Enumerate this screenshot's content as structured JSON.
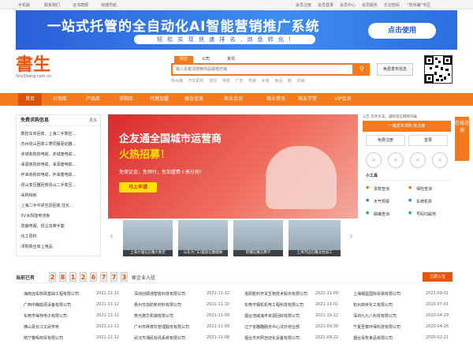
{
  "topbar": {
    "items": [
      "手机版",
      "联系我们",
      "证书荫铜",
      "快捷导航"
    ],
    "right": [
      "会员注册",
      "会员登录",
      "会员中心",
      "会员服务",
      "忘记密码",
      "“防伪骗”专区"
    ]
  },
  "banner": {
    "headline": "一站式托管的全自动化AI智能营销推广系统",
    "sub": "轻 松 实 现 快 速 排 名 , 询 盘 转 化 !",
    "button": "点击使用"
  },
  "logo": {
    "text": "書生",
    "domain": "ShuSheng.com.cn"
  },
  "search": {
    "tabs": [
      "供应",
      "公司",
      "资讯"
    ],
    "placeholder": "输入关键词搜索商品或者店铺",
    "hot": [
      "热水器",
      "汽车配件",
      "安防",
      "电缆",
      "广告",
      "男装",
      "女装",
      "食品",
      "鞋",
      "机械"
    ],
    "publish": "免费发布信息"
  },
  "nav": [
    "首页",
    "公司库",
    "产品库",
    "求购库",
    "代理加盟",
    "展会信息",
    "商业会议",
    "商业资讯",
    "商友学堂",
    "VIP会员"
  ],
  "left": {
    "title": "免费求购信息",
    "more": "更多",
    "items": [
      "·数控车床回收，上海二手数控...",
      "·苏州昆山回收三菱伺服驱动器...",
      "·赤城收购旧电缆，赤城废电缆...",
      "·涞源收购旧电缆，涞源废电缆...",
      "·怀来收购旧电缆，怀来废电缆...",
      "·昆山变压器回收昆山二手变压...",
      "·采购锌板",
      "·上海二手中央空调回收,住化...",
      "·5V太阳能电池板",
      "·防静电服，低尘凉爽手套",
      "·化工原料",
      "·求购真丝床上用品"
    ]
  },
  "hero": {
    "title1": "企友通全国城市运营商",
    "title2": "火热招募！",
    "line": "免保证金，免预付，免加盟费＋高分润！",
    "button": "马上申请"
  },
  "thumbs": [
    "上海大理石石雕大象定",
    "山东大门口摆放石雕貔貅",
    "新疆石雕石狮子",
    "上海河边石雕龙柱加工"
  ],
  "right": {
    "notice": "公告 年终岁末，谨防电信网络诈骗",
    "btn": "一键发布求购 免注册",
    "register": "免费注册",
    "login": "登录",
    "tools_title": "小工具",
    "tools": [
      "货款查询",
      "保险查询",
      "天气预报",
      "车牌机票",
      "邮编查询",
      "号码归属地"
    ],
    "float": "在线咨询"
  },
  "counter": {
    "label": "当前已有",
    "digits": [
      "2",
      "8",
      "1",
      "2",
      "6",
      "7",
      "7",
      "3"
    ],
    "suffix": "家企业入驻",
    "join": "立即入住"
  },
  "companies": [
    [
      "海南远佑劳政基础工程有限公司",
      "2021-11-12",
      "深圳创顺通智能科技有限公司",
      "2021-11-12",
      "洛阳乾科开关生物技术股份有限公司",
      "2021-11-09",
      "上海钢盈国际贸易有限公司",
      "2021-09-01"
    ],
    [
      "广西中胸能源设备有限公司",
      "2021-11-12",
      "惠州市加防新材料有限公司",
      "2021-11-10",
      "东莞市钢机机电工程科技有限公司",
      "2021-11-01",
      "杭州高侨化工有限公司",
      "2020-07-01"
    ],
    [
      "东莞市得林电子有限公司",
      "2021-11-12",
      "寿光德华机械有限公司",
      "2021-11-09",
      "烟台浩威海丰资源回收有限公司",
      "2021-10-22",
      "深圳九九八科技有限公司",
      "2020-04-29"
    ],
    [
      "佛山县长江文武学校",
      "2021-11-12",
      "广州市骅尊饮管理服务有限公司",
      "2021-11-09",
      "辽宁省瞄瞄服务中心法外劳业部",
      "2021-09-30",
      "宁夏圣泰环保科技有限公司",
      "2020-04-26"
    ],
    [
      "南宁春晖商贸有限公司",
      "2021-11-12",
      "武汉市湘民铃风系统有限公司",
      "2021-11-08",
      "烟台市天照自动化设备有限公司",
      "2021-09-22",
      "烟台喜牧食品有限公司",
      "2020-02-21"
    ]
  ]
}
